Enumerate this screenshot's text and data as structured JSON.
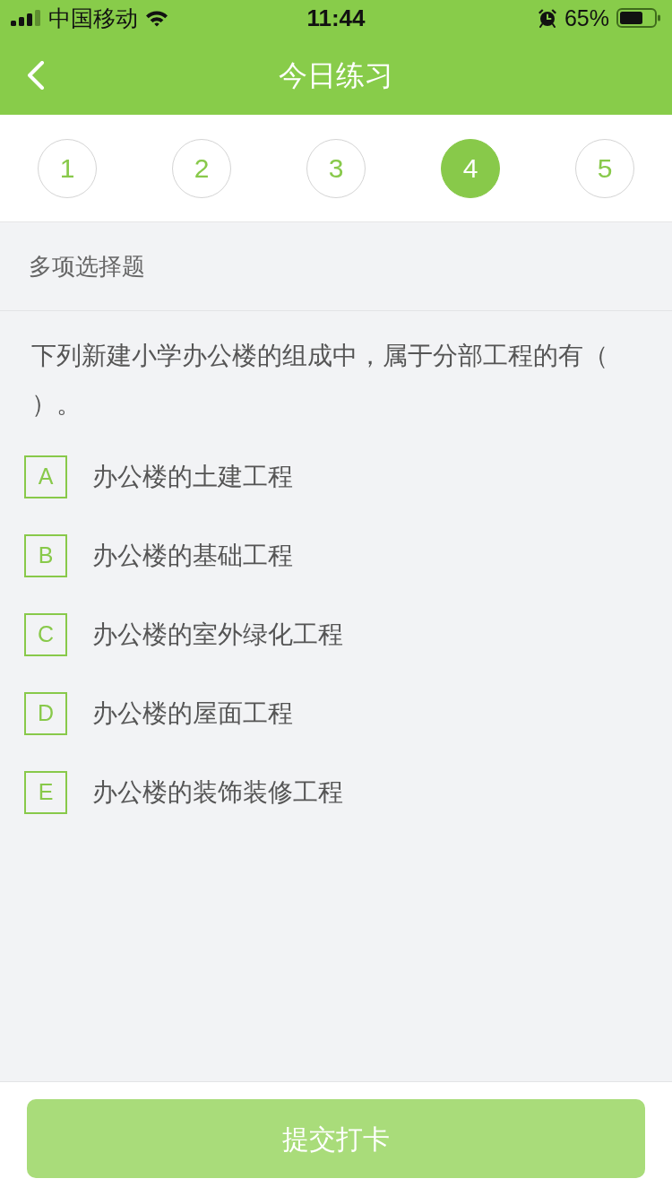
{
  "status_bar": {
    "carrier": "中国移动",
    "time": "11:44",
    "battery_percent": "65%"
  },
  "nav": {
    "title": "今日练习"
  },
  "question_tabs": [
    {
      "label": "1",
      "selected": false
    },
    {
      "label": "2",
      "selected": false
    },
    {
      "label": "3",
      "selected": false
    },
    {
      "label": "4",
      "selected": true
    },
    {
      "label": "5",
      "selected": false
    }
  ],
  "question_type": "多项选择题",
  "question": {
    "text": "下列新建小学办公楼的组成中，属于分部工程的有（）。",
    "options": [
      {
        "letter": "A",
        "text": "办公楼的土建工程",
        "selected": false
      },
      {
        "letter": "B",
        "text": "办公楼的基础工程",
        "selected": false
      },
      {
        "letter": "C",
        "text": "办公楼的室外绿化工程",
        "selected": false
      },
      {
        "letter": "D",
        "text": "办公楼的屋面工程",
        "selected": false
      },
      {
        "letter": "E",
        "text": "办公楼的装饰装修工程",
        "selected": false
      }
    ]
  },
  "submit_button": {
    "label": "提交打卡",
    "disabled": true
  }
}
